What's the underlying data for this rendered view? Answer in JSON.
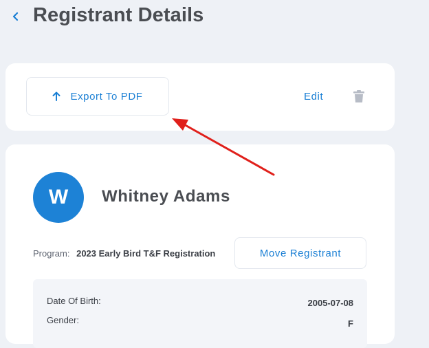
{
  "header": {
    "title": "Registrant Details"
  },
  "toolbar": {
    "export_label": "Export To PDF",
    "edit_label": "Edit"
  },
  "registrant": {
    "avatar_initial": "W",
    "name": "Whitney Adams",
    "program_label": "Program:",
    "program_value": "2023 Early Bird T&F Registration",
    "move_label": "Move Registrant",
    "fields": [
      {
        "label": "Date Of Birth:",
        "value": "2005-07-08"
      },
      {
        "label": "Gender:",
        "value": "F"
      }
    ]
  },
  "icons": {
    "back": "chevron-left-icon",
    "export": "arrow-up-icon",
    "delete": "trash-icon"
  },
  "colors": {
    "accent": "#1a7fd4",
    "avatar": "#1d82d6",
    "background": "#eef1f6",
    "annotation_arrow": "#e0201b"
  }
}
